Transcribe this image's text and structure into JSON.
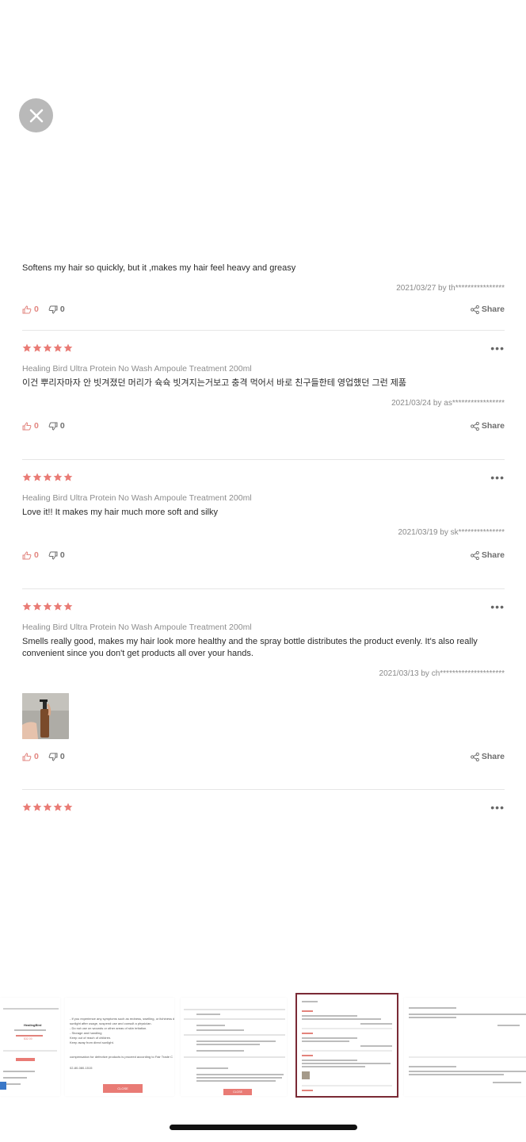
{
  "close_label": "×",
  "reviews": [
    {
      "text": "Softens my hair so quickly, but it ,makes my hair feel heavy and greasy",
      "meta": "2021/03/27 by th****************",
      "likes": "0",
      "dislikes": "0"
    },
    {
      "product": "Healing Bird Ultra Protein No Wash Ampoule Treatment 200ml",
      "text": "이건 뿌리자마자 안 빗겨졌던 머리가 슉슉 빗겨지는거보고 충격 먹어서 바로 친구들한테 영업했던 그런 제품",
      "meta": "2021/03/24 by as*****************",
      "likes": "0",
      "dislikes": "0"
    },
    {
      "product": "Healing Bird Ultra Protein No Wash Ampoule Treatment 200ml",
      "text": "Love it!! It makes my hair much more soft and silky",
      "meta": "2021/03/19 by sk***************",
      "likes": "0",
      "dislikes": "0"
    },
    {
      "product": "Healing Bird Ultra Protein No Wash Ampoule Treatment 200ml",
      "text": "Smells really good, makes my hair look more healthy and the spray bottle distributes the product evenly. It's also really convenient since you don't get products all over your hands.",
      "meta": "2021/03/13 by ch*********************",
      "likes": "0",
      "dislikes": "0"
    }
  ],
  "share_label": "Share",
  "more_label": "•••",
  "colors": {
    "star": "#e97b75",
    "accent_pink": "#e2857f",
    "selected_border": "#7a2a35"
  },
  "switcher": {
    "card1_brand": "HealingBird",
    "card1_price": "$32.00",
    "card2_line1": "- If you experience any symptoms such as redness, swelling, or itchiness d",
    "card2_line2": "sunlight after usage, suspend use and consult a physician.",
    "card2_line3": "- Do not use on wounds or other areas of skin irritation.",
    "card2_line4": "- Storage and handling",
    "card2_line5": "Keep out of reach of children.",
    "card2_line6": "Keep away from direct sunlight.",
    "card2_comp": "compensation for defective products is proceed according to Fair Trade C",
    "card2_phone": "02-80-080-1515",
    "card2_close": "CLOSE",
    "card3_close": "CLOSE"
  }
}
